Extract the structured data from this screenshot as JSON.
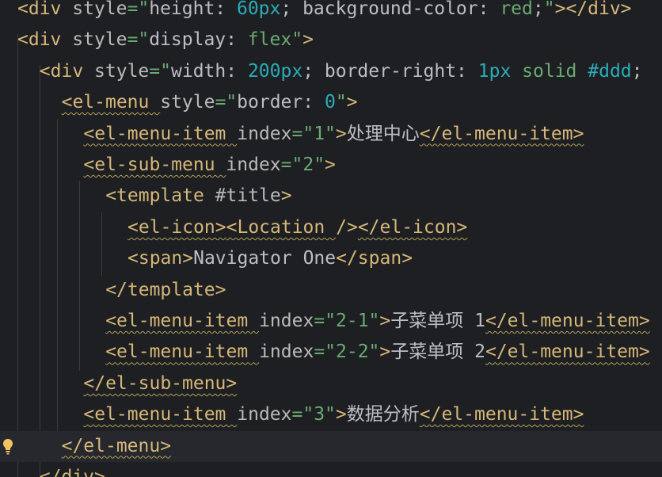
{
  "editor": {
    "language": "vue",
    "lines": [
      {
        "indent": "",
        "parts": [
          [
            "tag",
            "<div "
          ],
          [
            "attr",
            "style"
          ],
          [
            "str",
            "=\""
          ],
          [
            "txt",
            "height: "
          ],
          [
            "num",
            "60px"
          ],
          [
            "txt",
            "; background-color: "
          ],
          [
            "str",
            "red"
          ],
          [
            "txt",
            ";"
          ],
          [
            "str",
            "\""
          ],
          [
            "tag",
            "></div>"
          ]
        ]
      },
      {
        "indent": "",
        "parts": [
          [
            "tag",
            "<div "
          ],
          [
            "attr",
            "style"
          ],
          [
            "str",
            "=\""
          ],
          [
            "txt",
            "display: "
          ],
          [
            "str",
            "flex"
          ],
          [
            "str",
            "\""
          ],
          [
            "tag",
            ">"
          ]
        ]
      },
      {
        "indent": "  ",
        "parts": [
          [
            "tag",
            "<div "
          ],
          [
            "attr",
            "style"
          ],
          [
            "str",
            "=\""
          ],
          [
            "txt",
            "width: "
          ],
          [
            "num",
            "200px"
          ],
          [
            "txt",
            "; border-right: "
          ],
          [
            "num",
            "1px"
          ],
          [
            "txt",
            " "
          ],
          [
            "str",
            "solid"
          ],
          [
            "txt",
            " "
          ],
          [
            "num",
            "#ddd"
          ],
          [
            "txt",
            "; "
          ]
        ]
      },
      {
        "indent": "    ",
        "parts": [
          [
            "vue",
            "<el-menu "
          ],
          [
            "attr",
            "style"
          ],
          [
            "str",
            "=\""
          ],
          [
            "txt",
            "border: "
          ],
          [
            "num",
            "0"
          ],
          [
            "str",
            "\""
          ],
          [
            "tag",
            ">"
          ]
        ]
      },
      {
        "indent": "      ",
        "parts": [
          [
            "vue",
            "<el-menu-item "
          ],
          [
            "attr",
            "index"
          ],
          [
            "str",
            "=\"1\""
          ],
          [
            "tag",
            ">"
          ],
          [
            "txt",
            "处理中心"
          ],
          [
            "vue",
            "</el-menu-item>"
          ]
        ]
      },
      {
        "indent": "      ",
        "parts": [
          [
            "vue",
            "<el-sub-menu "
          ],
          [
            "attr",
            "index"
          ],
          [
            "str",
            "=\"2\""
          ],
          [
            "tag",
            ">"
          ]
        ]
      },
      {
        "indent": "        ",
        "parts": [
          [
            "tag",
            "<template "
          ],
          [
            "attr",
            "#title"
          ],
          [
            "tag",
            ">"
          ]
        ]
      },
      {
        "indent": "          ",
        "parts": [
          [
            "vue",
            "<el-icon>"
          ],
          [
            "vue",
            "<Location "
          ],
          [
            "tag",
            "/>"
          ],
          [
            "vue",
            "</el-icon>"
          ]
        ]
      },
      {
        "indent": "          ",
        "parts": [
          [
            "tag",
            "<span>"
          ],
          [
            "txt",
            "Navigator One"
          ],
          [
            "tag",
            "</span>"
          ]
        ]
      },
      {
        "indent": "        ",
        "parts": [
          [
            "tag",
            "</template>"
          ]
        ]
      },
      {
        "indent": "        ",
        "parts": [
          [
            "vue",
            "<el-menu-item "
          ],
          [
            "attr",
            "index"
          ],
          [
            "str",
            "=\"2-1\""
          ],
          [
            "tag",
            ">"
          ],
          [
            "txt",
            "子菜单项 1"
          ],
          [
            "vue",
            "</el-menu-item>"
          ]
        ]
      },
      {
        "indent": "        ",
        "parts": [
          [
            "vue",
            "<el-menu-item "
          ],
          [
            "attr",
            "index"
          ],
          [
            "str",
            "=\"2-2\""
          ],
          [
            "tag",
            ">"
          ],
          [
            "txt",
            "子菜单项 2"
          ],
          [
            "vue",
            "</el-menu-item>"
          ]
        ]
      },
      {
        "indent": "      ",
        "parts": [
          [
            "vue",
            "</el-sub-menu>"
          ]
        ]
      },
      {
        "indent": "      ",
        "parts": [
          [
            "vue",
            "<el-menu-item "
          ],
          [
            "attr",
            "index"
          ],
          [
            "str",
            "=\"3\""
          ],
          [
            "tag",
            ">"
          ],
          [
            "txt",
            "数据分析"
          ],
          [
            "vue",
            "</el-menu-item>"
          ]
        ]
      },
      {
        "indent": "    ",
        "parts": [
          [
            "vue",
            "</el-menu>"
          ]
        ]
      },
      {
        "indent": "  ",
        "parts": [
          [
            "tag",
            "</div>"
          ]
        ]
      }
    ],
    "current_line": 14,
    "intention_icon": "lightbulb-icon"
  },
  "colors": {
    "background": "#1e1f22",
    "tag": "#d5b778",
    "attribute": "#bababa",
    "string": "#6aab73",
    "number": "#2aacb8",
    "text": "#bcbec4",
    "bulb": "#f2c55c"
  }
}
